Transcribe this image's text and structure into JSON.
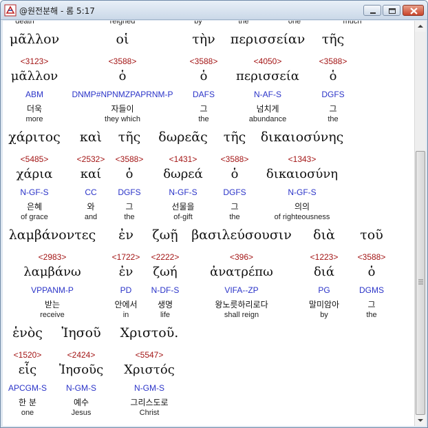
{
  "window": {
    "title": "@원전분해 - 롬 5:17",
    "minimize_label": "minimize",
    "maximize_label": "maximize",
    "close_label": "close"
  },
  "top_partial_row": [
    "death",
    "reigned",
    "by",
    "the",
    "one",
    "much"
  ],
  "rows": [
    {
      "words": [
        {
          "greek": "μᾶλλον",
          "strong": "<3123>",
          "lemma": "μᾶλλον",
          "parse": "ABM",
          "kor": "더욱",
          "eng": "more"
        },
        {
          "greek": "οἱ",
          "strong": "<3588>",
          "lemma": "ὁ",
          "parse": "DNMP#NPNMZPAPRNM-P",
          "parse_marker": "A",
          "kor": "자들이",
          "eng": "they which"
        },
        {
          "greek": "τὴν",
          "strong": "<3588>",
          "lemma": "ὁ",
          "parse": "DAFS",
          "kor": "그",
          "eng": "the"
        },
        {
          "greek": "περισσείαν",
          "strong": "<4050>",
          "lemma": "περισσεία",
          "parse": "N-AF-S",
          "kor": "넘치게",
          "eng": "abundance"
        },
        {
          "greek": "τῆς",
          "strong": "<3588>",
          "lemma": "ὁ",
          "parse": "DGFS",
          "kor": "그",
          "eng": "the"
        }
      ]
    },
    {
      "words": [
        {
          "greek": "χάριτος",
          "strong": "<5485>",
          "lemma": "χάρια",
          "parse": "N-GF-S",
          "kor": "은혜",
          "eng": "of grace"
        },
        {
          "greek": "καὶ",
          "strong": "<2532>",
          "lemma": "καί",
          "parse": "CC",
          "kor": "와",
          "eng": "and"
        },
        {
          "greek": "τῆς",
          "strong": "<3588>",
          "lemma": "ὁ",
          "parse": "DGFS",
          "kor": "그",
          "eng": "the"
        },
        {
          "greek": "δωρεᾶς",
          "strong": "<1431>",
          "lemma": "δωρεά",
          "parse": "N-GF-S",
          "kor": "선물을",
          "eng": "of-gift"
        },
        {
          "greek": "τῆς",
          "strong": "<3588>",
          "lemma": "ὁ",
          "parse": "DGFS",
          "kor": "그",
          "eng": "the"
        },
        {
          "greek": "δικαιοσύνης",
          "strong": "<1343>",
          "lemma": "δικαιοσύνη",
          "parse": "N-GF-S",
          "kor": "의의",
          "eng": "of righteousness"
        }
      ]
    },
    {
      "words": [
        {
          "greek": "λαμβάνοντες",
          "strong": "<2983>",
          "lemma": "λαμβάνω",
          "parse": "VPPANM-P",
          "kor": "받는",
          "eng": "receive"
        },
        {
          "greek": "ἐν",
          "strong": "<1722>",
          "lemma": "ἐν",
          "parse": "PD",
          "kor": "안에서",
          "eng": "in"
        },
        {
          "greek": "ζωῇ",
          "strong": "<2222>",
          "lemma": "ζωή",
          "parse": "N-DF-S",
          "kor": "생명",
          "eng": "life"
        },
        {
          "greek": "βασιλεύσουσιν",
          "strong": "<396>",
          "lemma": "ἀνατρέπω",
          "parse": "VIFA--ZP",
          "kor": "왕노릇하리로다",
          "eng": "shall reign"
        },
        {
          "greek": "διὰ",
          "strong": "<1223>",
          "lemma": "διά",
          "parse": "PG",
          "kor": "말미암아",
          "eng": "by"
        },
        {
          "greek": "τοῦ",
          "strong": "<3588>",
          "lemma": "ὁ",
          "parse": "DGMS",
          "kor": "그",
          "eng": "the"
        }
      ]
    },
    {
      "words": [
        {
          "greek": "ἑνὸς",
          "strong": "<1520>",
          "lemma": "εἷς",
          "parse": "APCGM-S",
          "kor": "한 분",
          "eng": "one"
        },
        {
          "greek": "Ἰησοῦ",
          "strong": "<2424>",
          "lemma": "Ἰησοῦς",
          "parse": "N-GM-S",
          "kor": "예수",
          "eng": "Jesus"
        },
        {
          "greek": "Χριστοῦ.",
          "strong": "<5547>",
          "lemma": "Χριστός",
          "parse": "N-GM-S",
          "kor": "그리스도로",
          "eng": "Christ"
        }
      ]
    }
  ]
}
